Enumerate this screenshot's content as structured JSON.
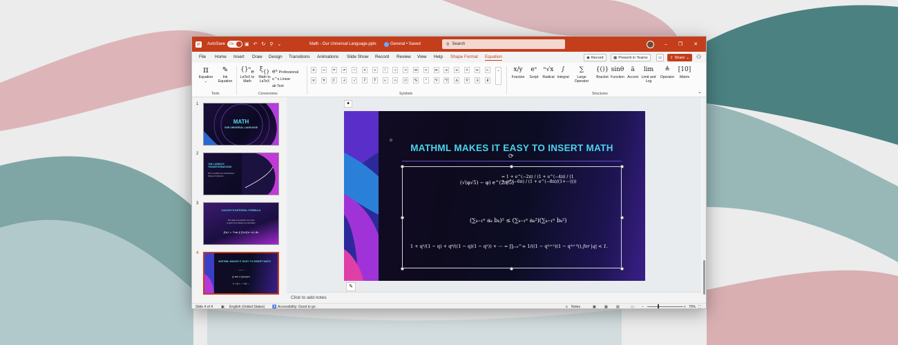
{
  "titlebar": {
    "autosave_label": "AutoSave",
    "autosave_state": "On",
    "file_title": "Math - Our Universal Language.pptx",
    "sensitivity": "General • Saved",
    "search_placeholder": "Search"
  },
  "tabs": [
    "File",
    "Home",
    "Insert",
    "Draw",
    "Design",
    "Transitions",
    "Animations",
    "Slide Show",
    "Record",
    "Review",
    "View",
    "Help",
    "Shape Format",
    "Equation"
  ],
  "selected_tab": "Equation",
  "tab_actions": {
    "record": "Record",
    "present": "Present in Teams",
    "share": "Share"
  },
  "ribbon": {
    "equation": "Equation",
    "ink_equation": "Ink Equation",
    "latex_to_math": "LaTeX to Math",
    "math_to_latex": "Math to LaTeX",
    "professional": "Professional",
    "linear": "Linear",
    "text": "Text",
    "groups": {
      "tools": "Tools",
      "conversions": "Conversions",
      "symbols": "Symbols",
      "structures": "Structures"
    },
    "symbols_row1": [
      "±",
      "∞",
      "=",
      "≠",
      "~",
      "×",
      "÷",
      "!",
      "∝",
      "<",
      "≪",
      ">",
      "≫",
      "≤",
      "≥",
      "∓",
      "≅",
      "≈"
    ],
    "symbols_row2": [
      "≡",
      "∀",
      "∁",
      "∂",
      "√",
      "∛",
      "∜",
      "∪",
      "∩",
      "∅",
      "%",
      "°",
      "℉",
      "℃",
      "∆",
      "∇",
      "∃",
      "∄"
    ],
    "structures": [
      "Fraction",
      "Script",
      "Radical",
      "Integral",
      "Large Operator",
      "Bracket",
      "Function",
      "Accent",
      "Limit and Log",
      "Operator",
      "Matrix"
    ],
    "structure_icons": [
      "x/y",
      "eˣ",
      "ⁿ√x",
      "∫",
      "∑",
      "{()}",
      "sinθ",
      "ä",
      "lim",
      "≜",
      "[10]"
    ]
  },
  "slides": [
    {
      "number": "1",
      "title": "MATH",
      "subtitle": "OUR UNIVERSAL LANGUAGE"
    },
    {
      "number": "2",
      "title": "THE LORENTZ TRANSFORMATIONS",
      "line1": "First, we define two simultaneous",
      "line2": "frames of reference"
    },
    {
      "number": "3",
      "title": "CAUCHY'S INTEGRAL FORMULA",
      "line1": "The value of a function f at a point",
      "line2": "is given by its values on a boundary"
    },
    {
      "number": "4",
      "title": "MATHML MAKES IT EASY TO INSERT MATH"
    }
  ],
  "main_slide": {
    "title": "MATHML MAKES IT EASY TO INSERT MATH",
    "eq1_left": "(√(φ√5) − φ) e^(2π/5)",
    "eq1_right": "= 1 + e^(−2π) / (1 + e^(−4π) / (1 + e^(−6π) / (1 + e^(−8π)/(1+⋯))))",
    "eq2": "(∑ₖ₌₁ⁿ aₖ bₖ)² ≤ (∑ₖ₌₁ⁿ aₖ²)(∑ₖ₌₁ⁿ bₖ²)",
    "eq3": "1 + q²/(1 − q) + q⁶/((1 − q)(1 − q²)) + ⋯ = ∏ⱼ₌₀^∞ 1/((1 − q⁵ʲ⁺²)(1 − q⁵ʲ⁺³)),",
    "eq3_cond": "for |q| < 1."
  },
  "notes_placeholder": "Click to add notes",
  "status": {
    "slide_of": "Slide 4 of 4",
    "language": "English (United States)",
    "accessibility": "Accessibility: Good to go",
    "notes": "Notes",
    "zoom": "70%"
  },
  "colors": {
    "accent": "#c43e1c",
    "title_teal": "#4ad6ec"
  }
}
